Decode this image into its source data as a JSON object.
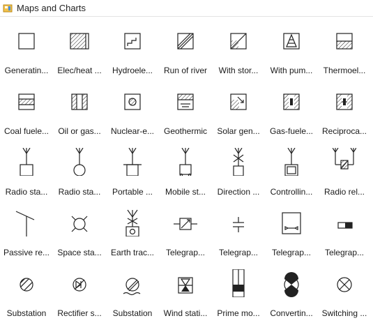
{
  "header": {
    "title": "Maps and Charts",
    "icon": "library-icon"
  },
  "items": [
    {
      "id": "generating-station",
      "label": "Generatin..."
    },
    {
      "id": "elec-heat",
      "label": "Elec/heat ..."
    },
    {
      "id": "hydroelectric",
      "label": "Hydroele..."
    },
    {
      "id": "run-of-river",
      "label": "Run of river"
    },
    {
      "id": "with-storage",
      "label": "With stor..."
    },
    {
      "id": "with-pumped",
      "label": "With pum..."
    },
    {
      "id": "thermoelectric",
      "label": "Thermoel..."
    },
    {
      "id": "coal-fueled",
      "label": "Coal fuele..."
    },
    {
      "id": "oil-or-gas",
      "label": "Oil or gas..."
    },
    {
      "id": "nuclear",
      "label": "Nuclear-e..."
    },
    {
      "id": "geothermic",
      "label": "Geothermic"
    },
    {
      "id": "solar",
      "label": "Solar gen..."
    },
    {
      "id": "gas-fueled",
      "label": "Gas-fuele..."
    },
    {
      "id": "reciprocating",
      "label": "Reciproca..."
    },
    {
      "id": "radio-station",
      "label": "Radio sta..."
    },
    {
      "id": "radio-station-2",
      "label": "Radio sta..."
    },
    {
      "id": "portable",
      "label": "Portable ..."
    },
    {
      "id": "mobile",
      "label": "Mobile st..."
    },
    {
      "id": "direction",
      "label": "Direction ..."
    },
    {
      "id": "controlling",
      "label": "Controllin..."
    },
    {
      "id": "radio-relay",
      "label": "Radio rel..."
    },
    {
      "id": "passive-relay",
      "label": "Passive re..."
    },
    {
      "id": "space-station",
      "label": "Space sta..."
    },
    {
      "id": "earth-tracking",
      "label": "Earth trac..."
    },
    {
      "id": "telegraph-1",
      "label": "Telegrap..."
    },
    {
      "id": "telegraph-2",
      "label": "Telegrap..."
    },
    {
      "id": "telegraph-3",
      "label": "Telegrap..."
    },
    {
      "id": "telegraph-4",
      "label": "Telegrap..."
    },
    {
      "id": "substation",
      "label": "Substation"
    },
    {
      "id": "rectifier",
      "label": "Rectifier s..."
    },
    {
      "id": "substation-2",
      "label": "Substation"
    },
    {
      "id": "wind-station",
      "label": "Wind stati..."
    },
    {
      "id": "prime-mover",
      "label": "Prime mo..."
    },
    {
      "id": "converting",
      "label": "Convertin..."
    },
    {
      "id": "switching",
      "label": "Switching ..."
    }
  ]
}
